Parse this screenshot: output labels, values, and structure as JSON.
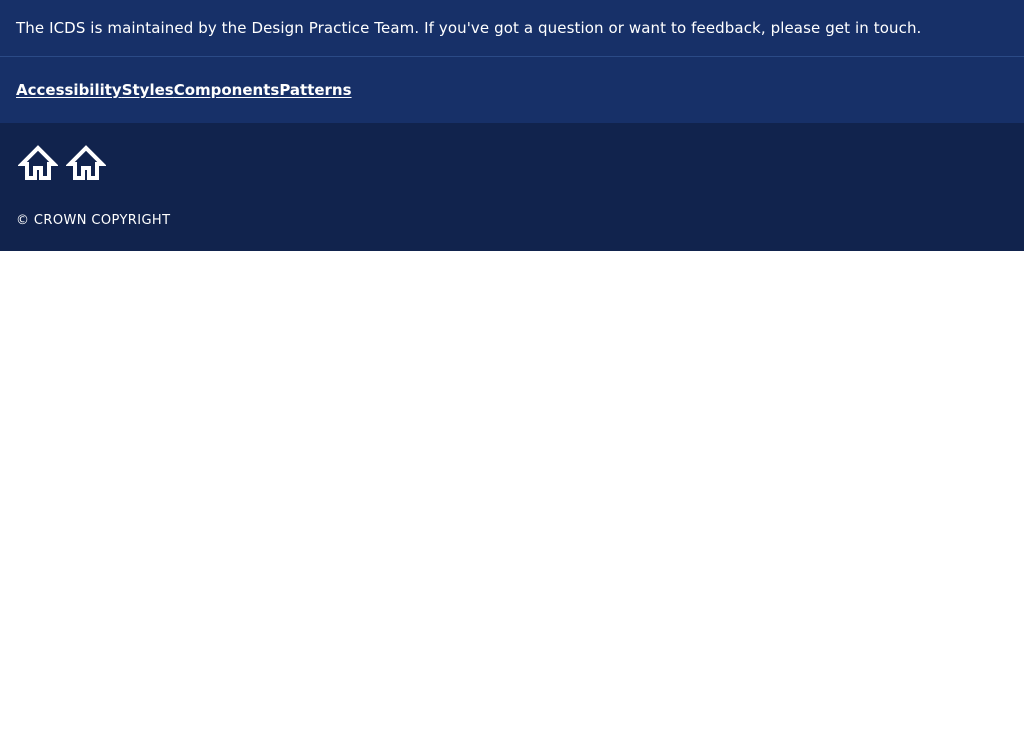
{
  "notice": {
    "text": "The ICDS is maintained by the Design Practice Team. If you've got a question or want to feedback, please get in touch."
  },
  "nav": {
    "links": [
      {
        "label": "Accessibility"
      },
      {
        "label": "Styles"
      },
      {
        "label": "Components"
      },
      {
        "label": "Patterns"
      }
    ]
  },
  "footer": {
    "logos": [
      "home-icon",
      "home-icon"
    ],
    "copyright": "© CROWN COPYRIGHT"
  },
  "colors": {
    "nav_background": "#173068",
    "footer_background": "#11234d",
    "text": "#ffffff"
  }
}
